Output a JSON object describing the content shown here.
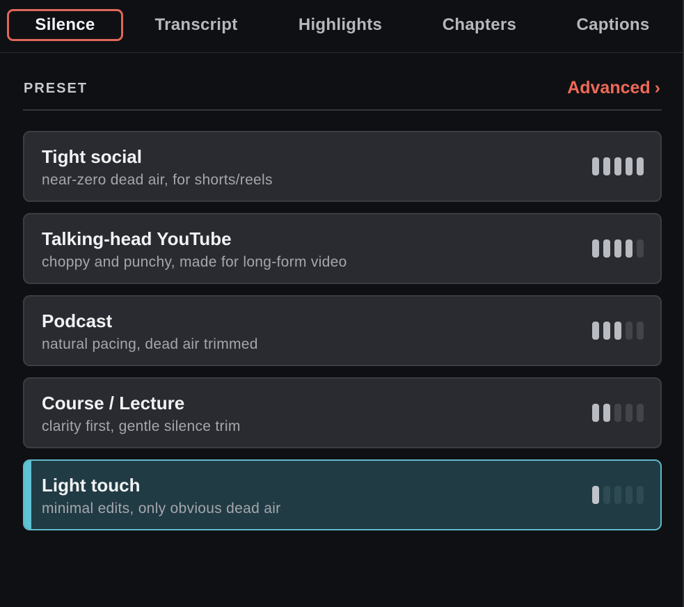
{
  "tabs": [
    {
      "label": "Silence",
      "active": true
    },
    {
      "label": "Transcript",
      "active": false
    },
    {
      "label": "Highlights",
      "active": false
    },
    {
      "label": "Chapters",
      "active": false
    },
    {
      "label": "Captions",
      "active": false
    }
  ],
  "section": {
    "title": "PRESET",
    "advanced_label": "Advanced",
    "advanced_chevron": "›"
  },
  "presets": [
    {
      "name": "Tight social",
      "description": "near-zero dead air, for shorts/reels",
      "level": 5,
      "max_level": 5,
      "selected": false
    },
    {
      "name": "Talking-head YouTube",
      "description": "choppy and punchy, made for long-form video",
      "level": 4,
      "max_level": 5,
      "selected": false
    },
    {
      "name": "Podcast",
      "description": "natural pacing, dead air trimmed",
      "level": 3,
      "max_level": 5,
      "selected": false
    },
    {
      "name": "Course / Lecture",
      "description": "clarity first, gentle silence trim",
      "level": 2,
      "max_level": 5,
      "selected": false
    },
    {
      "name": "Light touch",
      "description": "minimal edits, only obvious dead air",
      "level": 1,
      "max_level": 5,
      "selected": true
    }
  ],
  "colors": {
    "accent": "#ee6a58",
    "selected_border": "#5fb9c9",
    "background": "#0f1013"
  }
}
